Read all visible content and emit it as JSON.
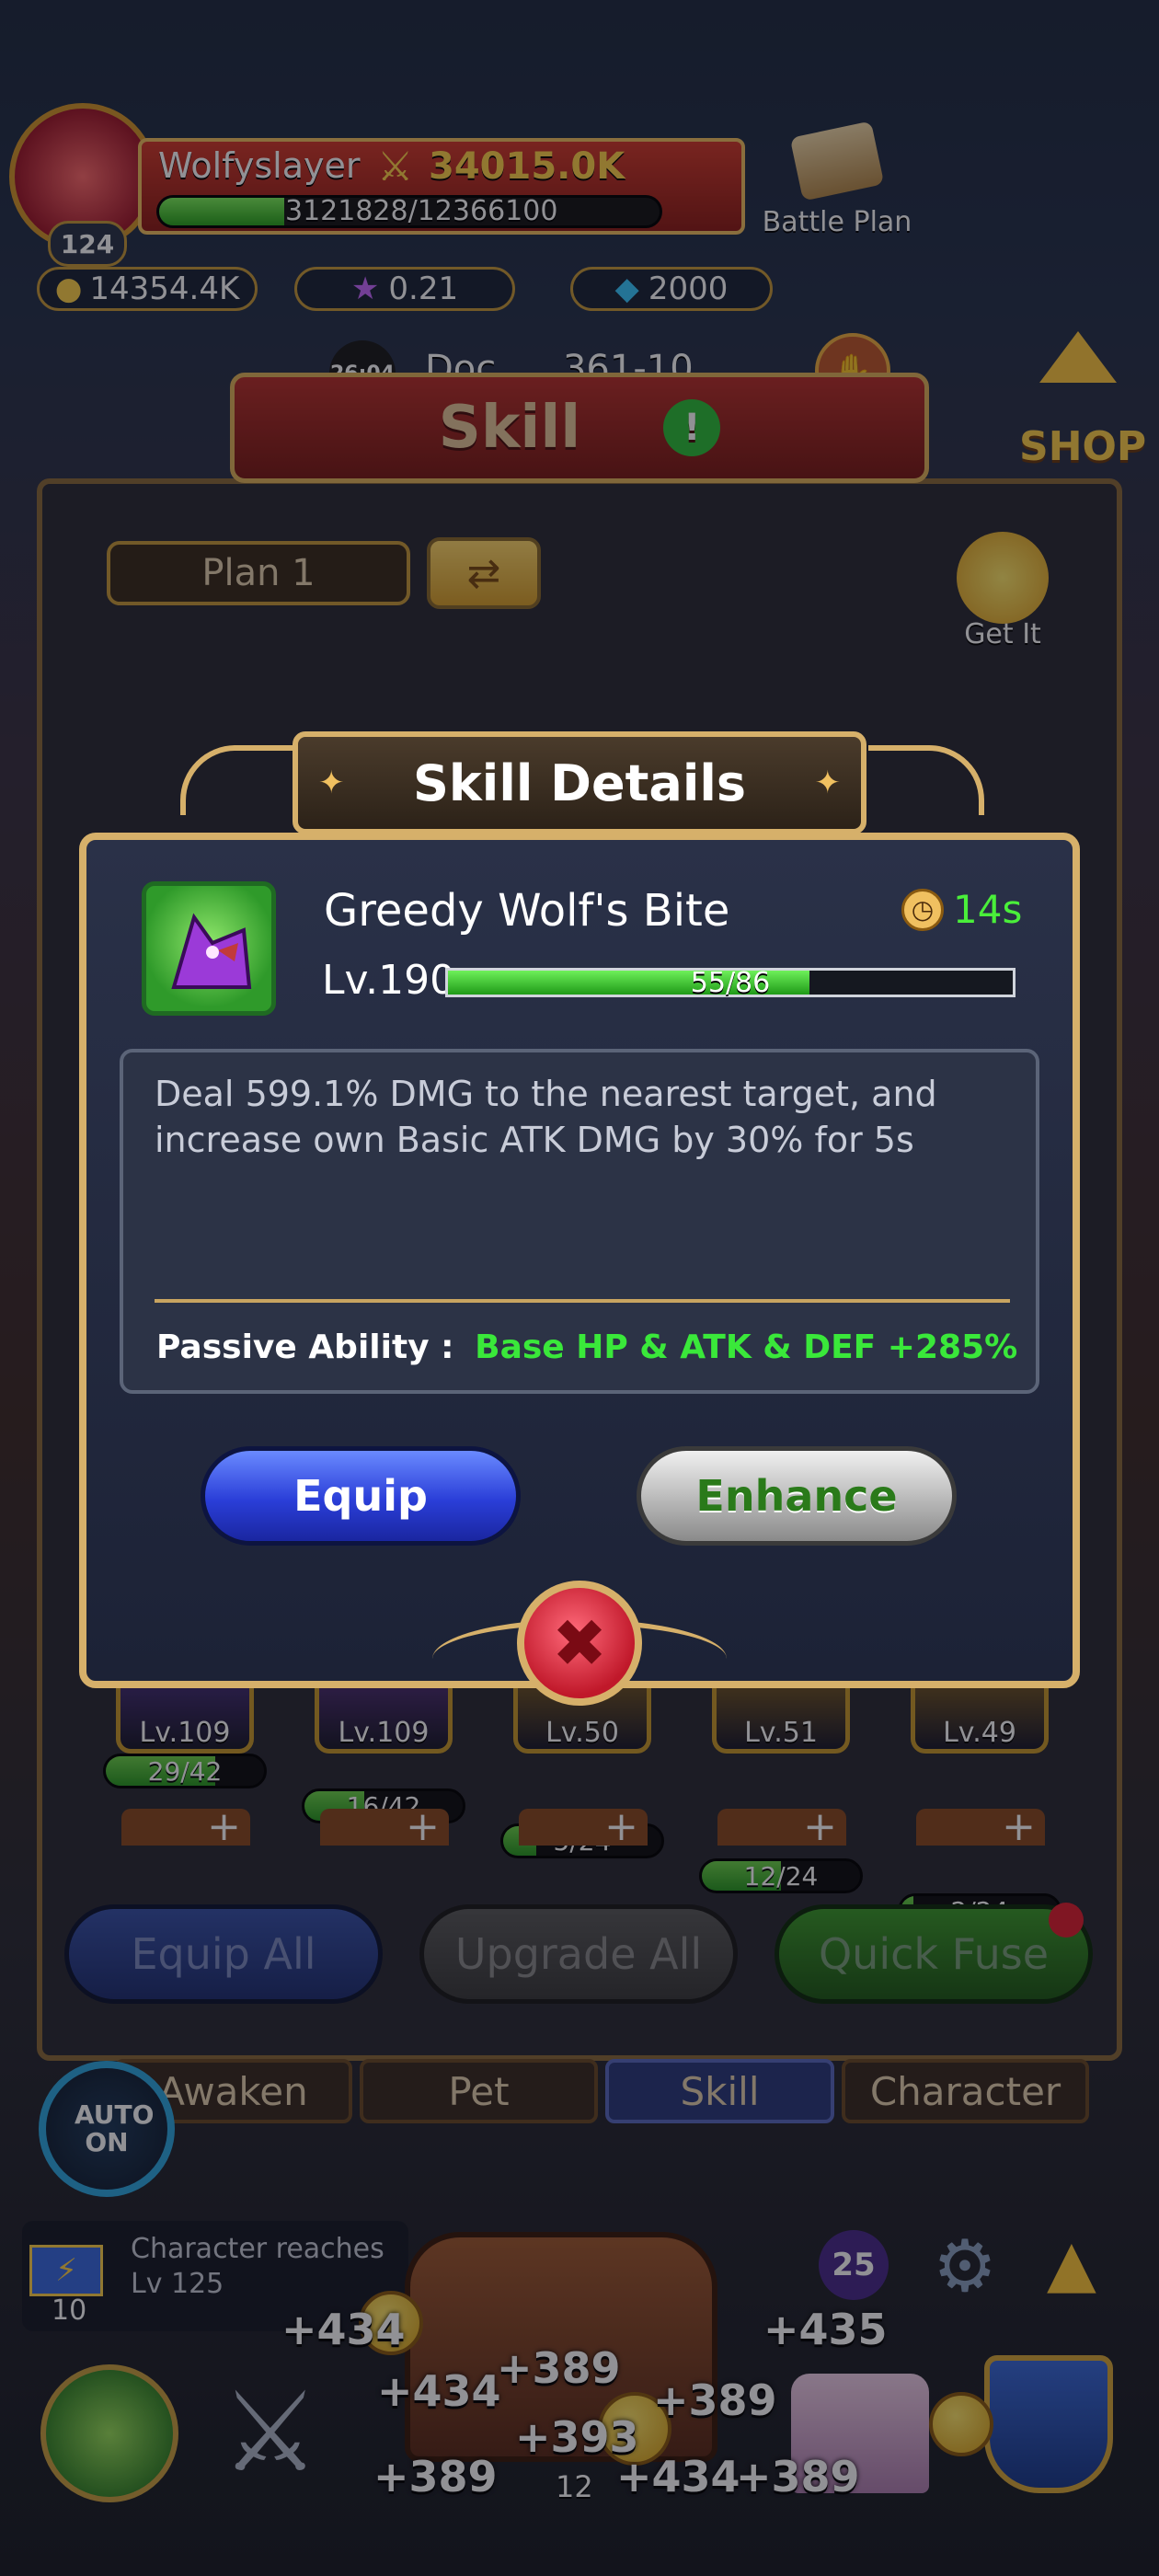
{
  "player": {
    "name": "Wolfyslayer",
    "power": "34015.0K",
    "exp_text": "3121828/12366100",
    "exp_fraction": 0.25,
    "level": "124",
    "coins": "14354.4K",
    "stars": "0.21",
    "gems": "2000"
  },
  "top": {
    "battle_plan_label": "Battle Plan",
    "timer": "26:04",
    "stage_text": "Doc",
    "stage_num": "361-10",
    "shop_label": "SHOP"
  },
  "skill_screen": {
    "title": "Skill",
    "plan_label": "Plan 1",
    "get_it_label": "Get It",
    "slots": [
      {
        "level": "Lv.109",
        "progress": "29/42",
        "fraction": 0.69,
        "color": "#6a3fb8"
      },
      {
        "level": "Lv.109",
        "progress": "16/42",
        "fraction": 0.38,
        "color": "#7a3fb0"
      },
      {
        "level": "Lv.50",
        "progress": "5/24",
        "fraction": 0.21,
        "color": "#c08a20"
      },
      {
        "level": "Lv.51",
        "progress": "12/24",
        "fraction": 0.5,
        "color": "#c08a20"
      },
      {
        "level": "Lv.49",
        "progress": "2/24",
        "fraction": 0.08,
        "color": "#c08a20"
      }
    ],
    "equip_all_label": "Equip All",
    "upgrade_all_label": "Upgrade All",
    "quick_fuse_label": "Quick Fuse"
  },
  "tabs": [
    "Awaken",
    "Pet",
    "Skill",
    "Character"
  ],
  "auto_label": "AUTO ON",
  "quest": {
    "text": "Character reaches Lv 125",
    "count": "10"
  },
  "bottom": {
    "badge_count": "25",
    "rewards": [
      "+434",
      "+435",
      "+434",
      "+389",
      "+389",
      "+393",
      "+389",
      "+434",
      "+389"
    ],
    "small_num": "12"
  },
  "dialog": {
    "title": "Skill Details",
    "skill_name": "Greedy Wolf's Bite",
    "cooldown": "14s",
    "level": "Lv.190",
    "progress_text": "55/86",
    "progress_fraction": 0.64,
    "description": "Deal 599.1% DMG to the nearest target, and increase own Basic ATK DMG by 30% for 5s",
    "passive_label": "Passive Ability :",
    "passive_value": "Base HP & ATK & DEF +285%",
    "equip_label": "Equip",
    "enhance_label": "Enhance"
  }
}
